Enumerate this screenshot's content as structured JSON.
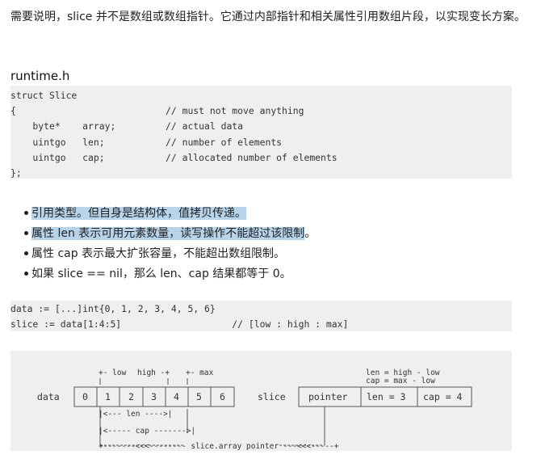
{
  "intro": "需要说明，slice 并不是数组或数组指针。它通过内部指针和相关属性引用数组片段，以实现变长方案。",
  "file_title": "runtime.h",
  "struct_code": [
    "struct Slice",
    "{                           // must not move anything",
    "    byte*    array;         // actual data",
    "    uintgo   len;           // number of elements",
    "    uintgo   cap;           // allocated number of elements",
    "};"
  ],
  "bullets": [
    {
      "text": "引用类型。但自身是结构体，值拷贝传递。",
      "highlighted": true
    },
    {
      "text": "属性 len 表示可用元素数量，读写操作不能超过该限制",
      "highlighted": true,
      "tail": "。"
    },
    {
      "text": "属性 cap 表示最大扩张容量，不能超出数组限制。",
      "highlighted": false
    },
    {
      "text": "如果 slice == nil，那么 len、cap 结果都等于 0。",
      "highlighted": false
    }
  ],
  "example_code": [
    "data := [...]int{0, 1, 2, 3, 4, 5, 6}",
    "slice := data[1:4:5]                    // [low : high : max]"
  ],
  "diagram": {
    "marker_low": "+- low",
    "marker_high": "high -+",
    "marker_max": "+- max",
    "len_formula": "len = high - low",
    "cap_formula": "cap = max  - low",
    "data_label": "data",
    "data_cells": [
      "0",
      "1",
      "2",
      "3",
      "4",
      "5",
      "6"
    ],
    "slice_label": "slice",
    "slice_fields": [
      "pointer",
      "len = 3",
      "cap = 4"
    ],
    "len_bracket": "|<--- len ---->|",
    "cap_bracket": "|<----- cap ------->|",
    "bottom_line": "+-------<<<-------- slice.array pointer ---<<<-----+"
  },
  "colors": {
    "code_background": "#efefef",
    "highlight": "#b7d4ea"
  }
}
